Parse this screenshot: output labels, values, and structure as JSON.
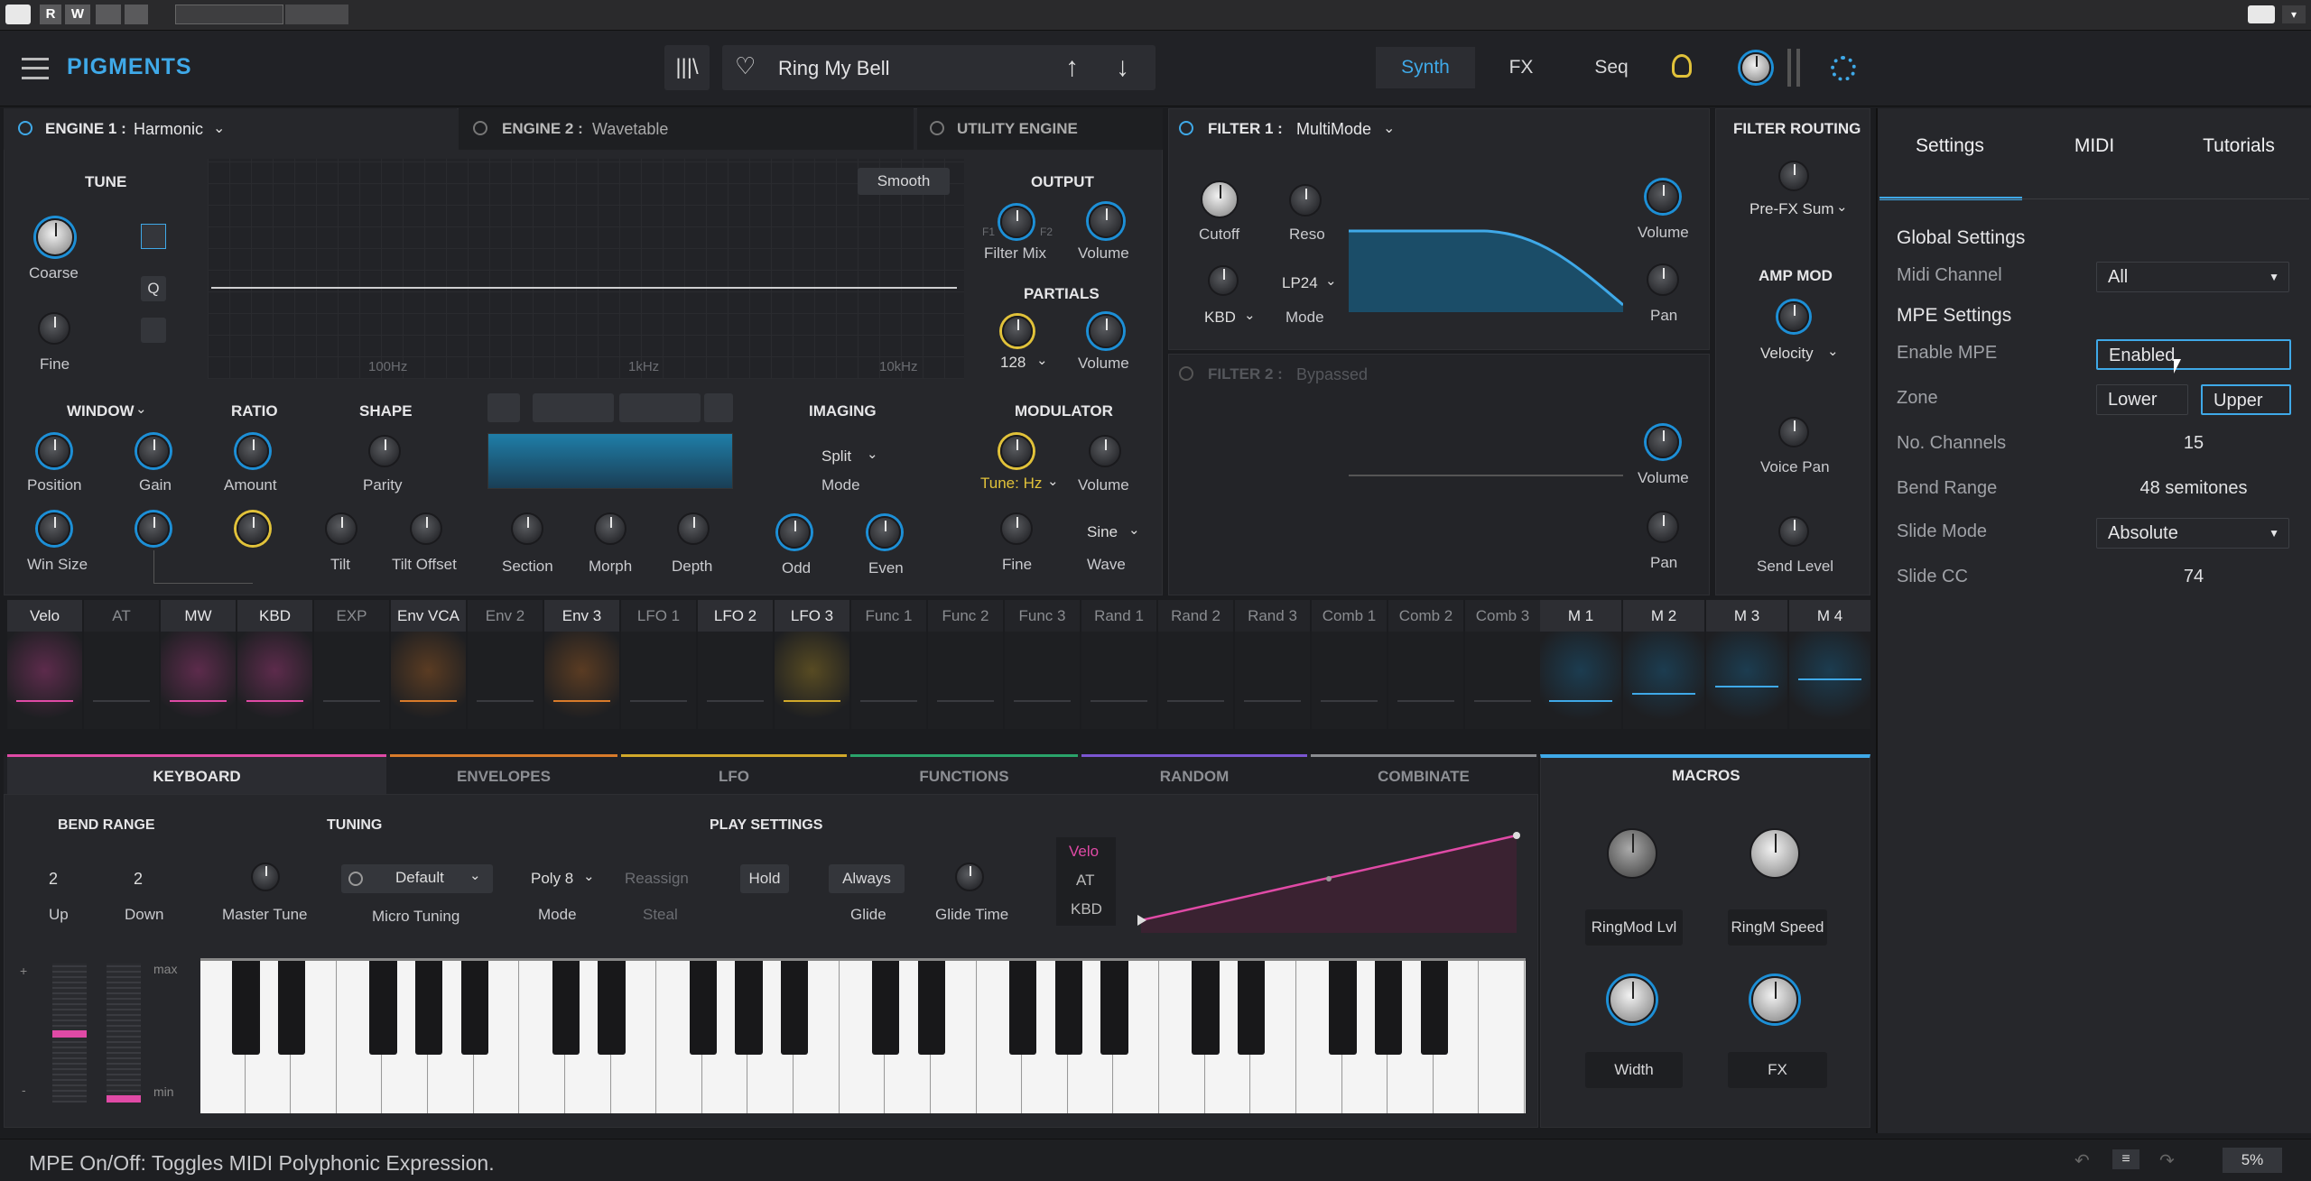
{
  "topbar": {
    "logo": "PIGMENTS",
    "preset_name": "Ring My Bell",
    "tabs": [
      "Synth",
      "FX",
      "Seq"
    ],
    "rec_buttons": [
      "R",
      "W"
    ]
  },
  "engine1": {
    "title": "ENGINE 1 :",
    "type": "Harmonic",
    "tune": "TUNE",
    "coarse": "Coarse",
    "fine": "Fine",
    "q": "Q",
    "smooth": "Smooth",
    "output": "OUTPUT",
    "filter_mix": "Filter Mix",
    "f1": "F1",
    "f2": "F2",
    "volume": "Volume",
    "partials": "PARTIALS",
    "partials_val": "128",
    "freq_labels": [
      "100Hz",
      "1kHz",
      "10kHz"
    ],
    "window": "WINDOW",
    "position": "Position",
    "gain": "Gain",
    "win_size": "Win Size",
    "ratio": "RATIO",
    "amount": "Amount",
    "shape": "SHAPE",
    "parity": "Parity",
    "tilt": "Tilt",
    "tilt_offset": "Tilt Offset",
    "section": "Section",
    "morph": "Morph",
    "depth": "Depth",
    "imaging": "IMAGING",
    "split": "Split",
    "mode": "Mode",
    "odd": "Odd",
    "even": "Even",
    "modulator": "MODULATOR",
    "tune_hz": "Tune: Hz",
    "mod_fine": "Fine",
    "sine": "Sine",
    "wave": "Wave"
  },
  "engine2": {
    "title": "ENGINE 2 :",
    "type": "Wavetable"
  },
  "utility": {
    "title": "UTILITY ENGINE"
  },
  "filter1": {
    "title": "FILTER 1 :",
    "type": "MultiMode",
    "cutoff": "Cutoff",
    "reso": "Reso",
    "kbd": "KBD",
    "lp24": "LP24",
    "mode": "Mode",
    "volume": "Volume",
    "pan": "Pan"
  },
  "filter2": {
    "title": "FILTER 2 :",
    "type": "Bypassed",
    "volume": "Volume",
    "pan": "Pan"
  },
  "routing": {
    "title": "FILTER ROUTING",
    "value": "Pre-FX Sum",
    "amp_mod": "AMP MOD",
    "velocity": "Velocity",
    "voice_pan": "Voice Pan",
    "send_level": "Send Level"
  },
  "mod_sources": [
    "Velo",
    "AT",
    "MW",
    "KBD",
    "EXP",
    "Env VCA",
    "Env 2",
    "Env 3",
    "LFO 1",
    "LFO 2",
    "LFO 3",
    "Func 1",
    "Func 2",
    "Func 3",
    "Rand 1",
    "Rand 2",
    "Rand 3",
    "Comb 1",
    "Comb 2",
    "Comb 3"
  ],
  "macro_sources": [
    "M 1",
    "M 2",
    "M 3",
    "M 4"
  ],
  "bottom_tabs": [
    "KEYBOARD",
    "ENVELOPES",
    "LFO",
    "FUNCTIONS",
    "RANDOM",
    "COMBINATE"
  ],
  "keyboard": {
    "bend_range": "BEND RANGE",
    "up_val": "2",
    "down_val": "2",
    "up": "Up",
    "down": "Down",
    "tuning": "TUNING",
    "master_tune": "Master Tune",
    "tuning_preset": "Default",
    "micro_tuning": "Micro Tuning",
    "play_settings": "PLAY SETTINGS",
    "poly": "Poly 8",
    "mode": "Mode",
    "reassign": "Reassign",
    "steal": "Steal",
    "hold": "Hold",
    "always": "Always",
    "glide": "Glide",
    "glide_time": "Glide Time",
    "velo": "Velo",
    "at": "AT",
    "kbd": "KBD",
    "max": "max",
    "min": "min",
    "plus": "+",
    "minus": "-"
  },
  "macros": {
    "title": "MACROS",
    "items": [
      "RingMod Lvl",
      "RingM Speed",
      "Width",
      "FX"
    ]
  },
  "right_panel": {
    "tabs": [
      "Settings",
      "MIDI",
      "Tutorials"
    ],
    "global_settings": "Global Settings",
    "midi_channel": "Midi Channel",
    "midi_channel_val": "All",
    "mpe_settings": "MPE Settings",
    "enable_mpe": "Enable MPE",
    "enable_mpe_val": "Enabled",
    "zone": "Zone",
    "zone_lower": "Lower",
    "zone_upper": "Upper",
    "no_channels": "No. Channels",
    "no_channels_val": "15",
    "bend_range": "Bend Range",
    "bend_range_val": "48 semitones",
    "slide_mode": "Slide Mode",
    "slide_mode_val": "Absolute",
    "slide_cc": "Slide CC",
    "slide_cc_val": "74"
  },
  "status": {
    "text": "MPE On/Off: Toggles MIDI Polyphonic Expression.",
    "cpu": "5%"
  },
  "colors": {
    "accent_blue": "#1d8fd6",
    "accent_yellow": "#e1c23a",
    "keyboard_pink": "#e04aa6"
  }
}
